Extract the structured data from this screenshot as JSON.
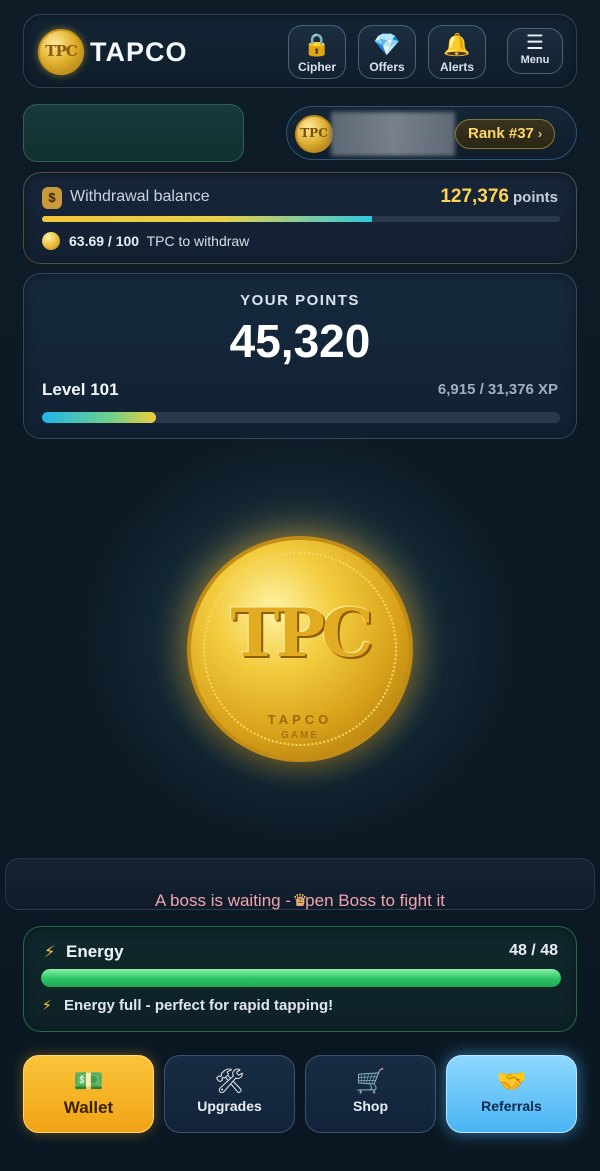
{
  "header": {
    "logo_text": "TPC",
    "brand": "TAPCO",
    "buttons": [
      {
        "label": "Cipher",
        "icon": "lock-icon"
      },
      {
        "label": "Offers",
        "icon": "diamond-icon"
      },
      {
        "label": "Alerts",
        "icon": "bell-icon"
      },
      {
        "label": "Menu",
        "icon": "hamburger-icon"
      }
    ]
  },
  "rank": {
    "coin_text": "TPC",
    "label": "Rank #37",
    "chevron": "›"
  },
  "withdrawal": {
    "title": "Withdrawal balance",
    "points_value": "127,376",
    "points_unit": "points",
    "progress_value": "63.69 / 100",
    "progress_text": "TPC to withdraw",
    "progress_fraction": 0.6369
  },
  "points": {
    "title": "YOUR POINTS",
    "value": "45,320",
    "level": "Level 101",
    "xp": "6,915 / 31,376 XP",
    "xp_fraction": 0.2204
  },
  "big_coin": {
    "text": "TPC",
    "brand": "TAPCO",
    "sub": "GAME"
  },
  "boss": {
    "icon": "crown-icon",
    "text": "A boss is waiting - open Boss to fight it"
  },
  "energy": {
    "title": "Energy",
    "value": "48 / 48",
    "fraction": 1.0,
    "message": "Energy full - perfect for rapid tapping!"
  },
  "nav": [
    {
      "label": "Wallet",
      "icon": "money-icon"
    },
    {
      "label": "Upgrades",
      "icon": "tools-icon"
    },
    {
      "label": "Shop",
      "icon": "cart-icon"
    },
    {
      "label": "Referrals",
      "icon": "handshake-icon"
    }
  ],
  "colors": {
    "accent_gold": "#ffd34d",
    "energy_green": "#2fc866",
    "referrals_blue": "#4ab4f3",
    "boss_text": "#f0a4b0"
  }
}
